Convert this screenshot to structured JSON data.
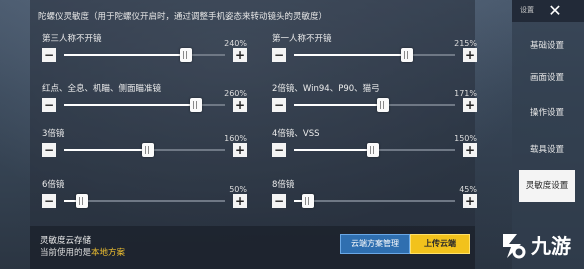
{
  "header": {
    "title": "陀螺仪灵敏度（用于陀螺仪开启时，通过调整手机姿态来转动镜头的灵敏度）"
  },
  "settings": [
    {
      "label": "第三人称不开镜",
      "value_text": "240%",
      "level": 0.76
    },
    {
      "label": "第一人称不开镜",
      "value_text": "215%",
      "level": 0.7
    },
    {
      "label": "红点、全息、机瞄、侧面瞄准镜",
      "value_text": "260%",
      "level": 0.82
    },
    {
      "label": "2倍镜、Win94、P90、猫弓",
      "value_text": "171%",
      "level": 0.55
    },
    {
      "label": "3倍镜",
      "value_text": "160%",
      "level": 0.52
    },
    {
      "label": "4倍镜、VSS",
      "value_text": "150%",
      "level": 0.49
    },
    {
      "label": "6倍镜",
      "value_text": "50%",
      "level": 0.11
    },
    {
      "label": "8倍镜",
      "value_text": "45%",
      "level": 0.09
    }
  ],
  "controls": {
    "minus": "−",
    "plus": "+"
  },
  "cloud": {
    "title": "灵敏度云存储",
    "current_prefix": "当前使用的是",
    "current_plan": "本地方案",
    "manage_label": "云端方案管理",
    "upload_label": "上传云端"
  },
  "sidebar": {
    "title": "设置",
    "close": "✕",
    "items": [
      "基础设置",
      "画面设置",
      "操作设置",
      "载具设置",
      "灵敏度设置"
    ],
    "active_index": 4
  },
  "watermark": {
    "text": "九游"
  }
}
